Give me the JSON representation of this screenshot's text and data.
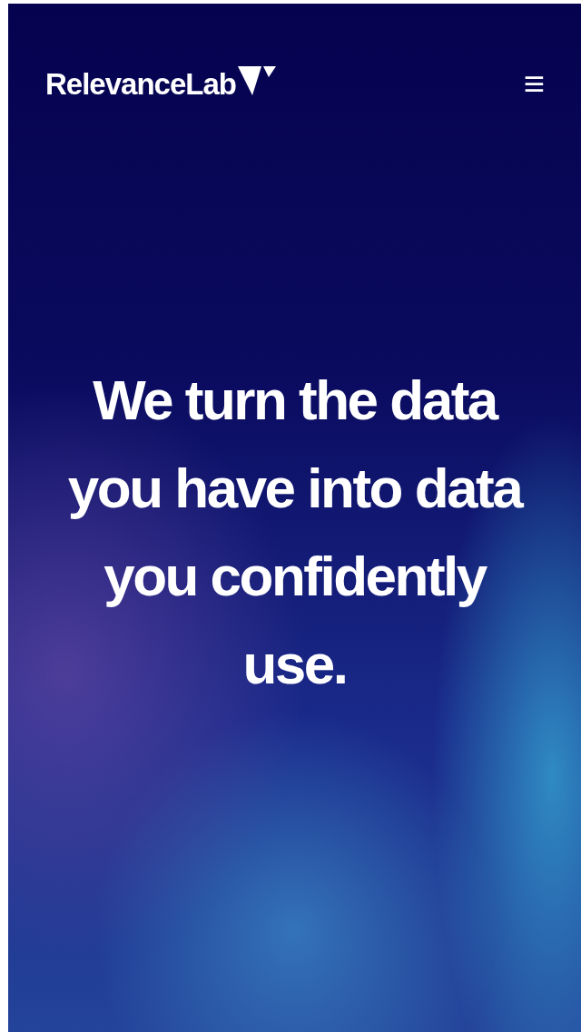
{
  "header": {
    "logo": "RelevanceLab",
    "menu_icon": "≡"
  },
  "hero": {
    "headline": "We turn the data you have into data you confidently use."
  }
}
